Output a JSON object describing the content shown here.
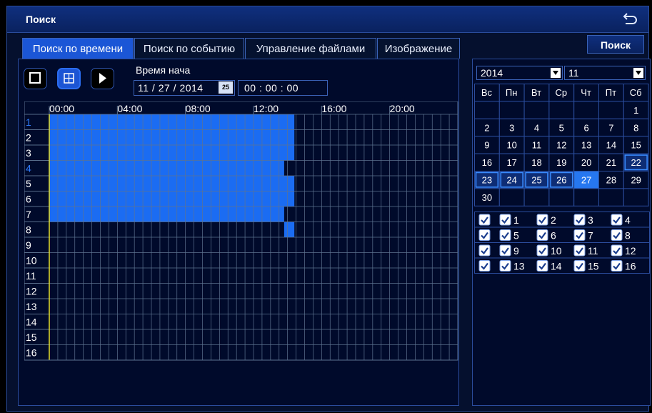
{
  "window": {
    "title": "Поиск"
  },
  "tabs": [
    "Поиск по времени",
    "Поиск по событию",
    "Управление файлами",
    "Изображение"
  ],
  "active_tab": 0,
  "search_button": "Поиск",
  "start_time": {
    "label": "Время нача",
    "date": "11 / 27 / 2014",
    "calendar_icon_text": "25",
    "time": "00  :  00  :  00"
  },
  "timeline": {
    "hour_labels": [
      "00:00",
      "04:00",
      "08:00",
      "12:00",
      "16:00",
      "20:00"
    ],
    "channels": [
      "1",
      "2",
      "3",
      "4",
      "5",
      "6",
      "7",
      "8",
      "9",
      "10",
      "11",
      "12",
      "13",
      "14",
      "15",
      "16"
    ],
    "highlighted_channels": [
      1,
      4
    ],
    "recordings": [
      {
        "channel": 1,
        "end_hour": 14.4
      },
      {
        "channel": 2,
        "end_hour": 14.4
      },
      {
        "channel": 3,
        "end_hour": 14.4
      },
      {
        "channel": 4,
        "end_hour": 13.8
      },
      {
        "channel": 5,
        "end_hour": 14.4
      },
      {
        "channel": 6,
        "end_hour": 14.4
      },
      {
        "channel": 7,
        "end_hour": 13.8
      },
      {
        "channel": 8,
        "start_hour": 13.8,
        "end_hour": 14.4
      }
    ],
    "colors": {
      "recording": "#1b6cf2",
      "grid": "#5d7390",
      "channel_highlight": "#2f7af7",
      "cursor": "#e5e02a"
    }
  },
  "calendar": {
    "year": "2014",
    "month": "11",
    "weekdays": [
      "Вс",
      "Пн",
      "Вт",
      "Ср",
      "Чт",
      "Пт",
      "Сб"
    ],
    "weeks": [
      [
        "",
        "",
        "",
        "",
        "",
        "",
        "1"
      ],
      [
        "2",
        "3",
        "4",
        "5",
        "6",
        "7",
        "8"
      ],
      [
        "9",
        "10",
        "11",
        "12",
        "13",
        "14",
        "15"
      ],
      [
        "16",
        "17",
        "18",
        "19",
        "20",
        "21",
        "22"
      ],
      [
        "23",
        "24",
        "25",
        "26",
        "27",
        "28",
        "29"
      ],
      [
        "30",
        "",
        "",
        "",
        "",
        "",
        ""
      ]
    ],
    "record_days": [
      "22",
      "23",
      "24",
      "25",
      "26"
    ],
    "selected_day": "27"
  },
  "channel_checks": {
    "all_checked": true,
    "rows": [
      [
        "1",
        "2",
        "3",
        "4"
      ],
      [
        "5",
        "6",
        "7",
        "8"
      ],
      [
        "9",
        "10",
        "11",
        "12"
      ],
      [
        "13",
        "14",
        "15",
        "16"
      ]
    ]
  }
}
